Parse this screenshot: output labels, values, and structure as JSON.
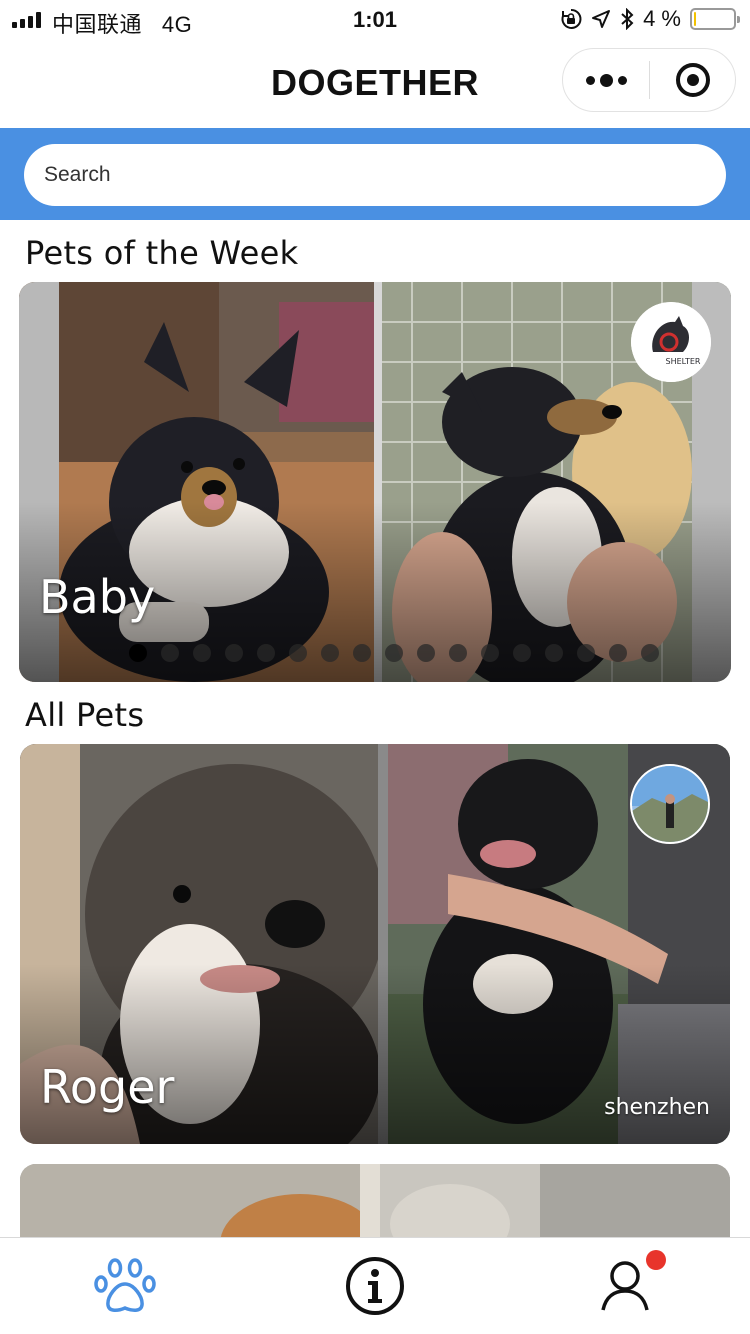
{
  "status_bar": {
    "carrier": "中国联通",
    "network": "4G",
    "time": "1:01",
    "battery_percent": "4 %",
    "battery_level": 0.04,
    "icons": [
      "rotation-lock-icon",
      "location-arrow-icon",
      "bluetooth-icon"
    ]
  },
  "header": {
    "title": "DOGETHER",
    "more_icon": "more-dots-icon",
    "close_icon": "target-close-icon"
  },
  "search": {
    "placeholder": "Search",
    "background_color": "#4a90e2"
  },
  "sections": {
    "featured_title": "Pets of the Week",
    "all_title": "All Pets"
  },
  "featured_card": {
    "name": "Baby",
    "badge_icon": "shelter-logo-icon",
    "badge_text": "SHELTER",
    "carousel_pages": 17,
    "active_page": 1
  },
  "pet_list": [
    {
      "name": "Roger",
      "location": "shenzhen",
      "badge_icon": "owner-avatar-icon"
    }
  ],
  "tab_bar": {
    "items": [
      {
        "icon": "paw-icon",
        "active": true,
        "color": "#4a90e2"
      },
      {
        "icon": "info-icon",
        "active": false,
        "color": "#111111"
      },
      {
        "icon": "profile-icon",
        "active": false,
        "color": "#111111",
        "notification": true
      }
    ],
    "notification_color": "#e8342b"
  }
}
